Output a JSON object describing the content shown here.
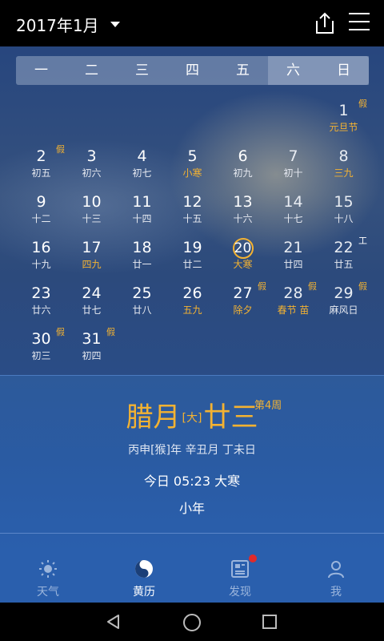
{
  "header": {
    "month_label": "2017年1月"
  },
  "weekdays": [
    "一",
    "二",
    "三",
    "四",
    "五",
    "六",
    "日"
  ],
  "days": [
    {
      "n": "1",
      "lunar": "元旦节",
      "hl": true,
      "badge": "假",
      "row": 0,
      "col": 6
    },
    {
      "n": "2",
      "lunar": "初五",
      "badge": "假",
      "row": 1,
      "col": 0
    },
    {
      "n": "3",
      "lunar": "初六",
      "row": 1,
      "col": 1
    },
    {
      "n": "4",
      "lunar": "初七",
      "row": 1,
      "col": 2
    },
    {
      "n": "5",
      "lunar": "小寒",
      "hl": true,
      "row": 1,
      "col": 3
    },
    {
      "n": "6",
      "lunar": "初九",
      "row": 1,
      "col": 4
    },
    {
      "n": "7",
      "lunar": "初十",
      "row": 1,
      "col": 5
    },
    {
      "n": "8",
      "lunar": "三九",
      "hl": true,
      "row": 1,
      "col": 6
    },
    {
      "n": "9",
      "lunar": "十二",
      "row": 2,
      "col": 0
    },
    {
      "n": "10",
      "lunar": "十三",
      "row": 2,
      "col": 1
    },
    {
      "n": "11",
      "lunar": "十四",
      "row": 2,
      "col": 2
    },
    {
      "n": "12",
      "lunar": "十五",
      "row": 2,
      "col": 3
    },
    {
      "n": "13",
      "lunar": "十六",
      "row": 2,
      "col": 4
    },
    {
      "n": "14",
      "lunar": "十七",
      "row": 2,
      "col": 5
    },
    {
      "n": "15",
      "lunar": "十八",
      "row": 2,
      "col": 6
    },
    {
      "n": "16",
      "lunar": "十九",
      "row": 3,
      "col": 0
    },
    {
      "n": "17",
      "lunar": "四九",
      "hl": true,
      "row": 3,
      "col": 1
    },
    {
      "n": "18",
      "lunar": "廿一",
      "row": 3,
      "col": 2
    },
    {
      "n": "19",
      "lunar": "廿二",
      "row": 3,
      "col": 3
    },
    {
      "n": "20",
      "lunar": "大寒",
      "hl": true,
      "today": true,
      "row": 3,
      "col": 4
    },
    {
      "n": "21",
      "lunar": "廿四",
      "row": 3,
      "col": 5
    },
    {
      "n": "22",
      "lunar": "廿五",
      "badge": "工",
      "work": true,
      "row": 3,
      "col": 6
    },
    {
      "n": "23",
      "lunar": "廿六",
      "row": 4,
      "col": 0
    },
    {
      "n": "24",
      "lunar": "廿七",
      "row": 4,
      "col": 1
    },
    {
      "n": "25",
      "lunar": "廿八",
      "row": 4,
      "col": 2
    },
    {
      "n": "26",
      "lunar": "五九",
      "hl": true,
      "row": 4,
      "col": 3
    },
    {
      "n": "27",
      "lunar": "除夕",
      "hl": true,
      "badge": "假",
      "row": 4,
      "col": 4
    },
    {
      "n": "28",
      "lunar": "春节 苗",
      "hl": true,
      "badge": "假",
      "row": 4,
      "col": 5
    },
    {
      "n": "29",
      "lunar": "麻风日",
      "badge": "假",
      "row": 4,
      "col": 6
    },
    {
      "n": "30",
      "lunar": "初三",
      "badge": "假",
      "row": 5,
      "col": 0
    },
    {
      "n": "31",
      "lunar": "初四",
      "badge": "假",
      "row": 5,
      "col": 1
    }
  ],
  "detail": {
    "lunar_month": "腊月",
    "month_size": "[大]",
    "lunar_day": "廿三",
    "week": "第4周",
    "ganzhi": "丙申[猴]年  辛丑月  丁未日",
    "solar_term": "今日 05:23 大寒",
    "festival": "小年"
  },
  "nav": [
    {
      "label": "天气",
      "icon": "sun-icon"
    },
    {
      "label": "黄历",
      "icon": "yin-yang-icon"
    },
    {
      "label": "发现",
      "icon": "news-icon"
    },
    {
      "label": "我",
      "icon": "person-icon"
    }
  ],
  "colors": {
    "accent": "#f3b232",
    "nav_bg": "#2a5fad",
    "badge_red": "#e02a2a"
  }
}
